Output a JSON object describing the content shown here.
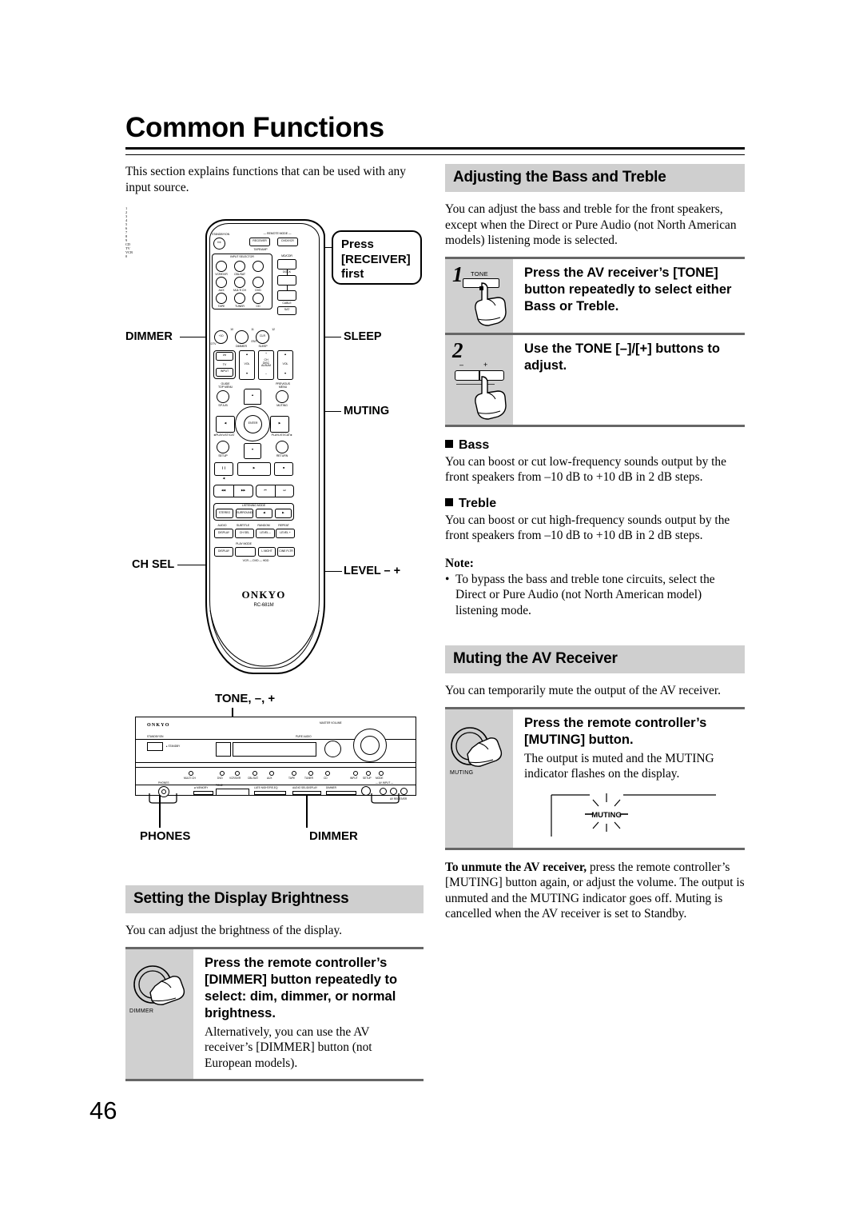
{
  "page": {
    "title": "Common Functions",
    "number": "46",
    "intro": "This section explains functions that can be used with any input source."
  },
  "sections": {
    "bass_treble": {
      "heading": "Adjusting the Bass and Treble",
      "intro": "You can adjust the bass and treble for the front speakers, except when the Direct or Pure Audio (not North American models) listening mode is selected.",
      "steps": [
        {
          "num": "1",
          "icon_label": "TONE",
          "title": "Press the AV receiver’s [TONE] button repeatedly to select either Bass or Treble.",
          "body": ""
        },
        {
          "num": "2",
          "icon_label_minus": "–",
          "icon_label_plus": "+",
          "title": "Use the TONE [–]/[+] buttons to adjust.",
          "body": ""
        }
      ],
      "subsections": [
        {
          "heading": "Bass",
          "body": "You can boost or cut low-frequency sounds output by the front speakers from –10 dB to +10 dB in 2 dB steps."
        },
        {
          "heading": "Treble",
          "body": "You can boost or cut high-frequency sounds output by the front speakers from –10 dB to +10 dB in 2 dB steps."
        }
      ],
      "note_label": "Note:",
      "notes": [
        "To bypass the bass and treble tone circuits, select the Direct or Pure Audio (not North American model) listening mode."
      ]
    },
    "muting": {
      "heading": "Muting the AV Receiver",
      "intro": "You can temporarily mute the output of the AV receiver.",
      "step": {
        "icon_label": "MUTING",
        "title": "Press the remote controller’s [MUTING] button.",
        "body": "The output is muted and the MUTING indicator flashes on the display.",
        "display_indicator": "MUTING"
      },
      "unmute_lead": "To unmute the AV receiver,",
      "unmute_body": " press the remote controller’s [MUTING] button again, or adjust the volume. The output is unmuted and the MUTING indicator goes off. Muting is cancelled when the AV receiver is set to Standby."
    },
    "display_brightness": {
      "heading": "Setting the Display Brightness",
      "intro": "You can adjust the brightness of the display.",
      "step": {
        "icon_label": "DIMMER",
        "title": "Press the remote controller’s [DIMMER] button repeatedly to select: dim, dimmer, or normal brightness.",
        "body": "Alternatively, you can use the AV receiver’s [DIMMER] button (not European models)."
      }
    }
  },
  "remote_figure": {
    "callout": "Press [RECEIVER] first",
    "model": "RC-681M",
    "brand": "ONKYO",
    "callouts": {
      "dimmer": "DIMMER",
      "sleep": "SLEEP",
      "muting": "MUTING",
      "ch_sel": "CH SEL",
      "level": "LEVEL – +"
    },
    "labels": {
      "standby": "STANDBY/ON",
      "remote_mode": "REMOTE MODE",
      "receiver_key": "RECEIVER",
      "dvd_key": "DVD/VCR",
      "tape_amp": "TAPE/AMP",
      "md_cdr": "MD/CDR",
      "cd_key": "CD",
      "dock": "DOCK",
      "tv_key": "TV",
      "vcr_key": "VCR",
      "cable": "CABLE",
      "sat_key": "SAT",
      "input_selector": "INPUT SELECTOR",
      "keys": [
        "1",
        "2",
        "3",
        "4",
        "5",
        "6",
        "7",
        "8",
        "9",
        "+10",
        "0",
        "CLR"
      ],
      "key_subs": [
        "VCR/DVR",
        "CBL/SAT",
        "",
        "AUX",
        "MULTI CH",
        "DVD",
        "TAPE",
        "TUNER",
        "CD"
      ],
      "key_nums": [
        "10",
        "11",
        "12"
      ],
      "dimmer_sub": "DIMMER",
      "sleep_sub": "SLEEP",
      "ent_sub": "ENT",
      "dtv_sub": "DTV",
      "tv_row": "TV",
      "vol": "VOL",
      "input_key": "INPUT",
      "ch_disc_album": "CH DISC ALBUM",
      "plus": "+",
      "minus": "–",
      "guide_top_menu": "GUIDE TOP MENU",
      "previous_menu": "PREVIOUS MENU",
      "sp_ab": "SP A /B",
      "muting_sub": "MUTING",
      "enter": "ENTER",
      "playlist_cat_l": "◄PLAYLIST/CAT",
      "playlist_cat_r": "PLAYLIST/CAT►",
      "setup": "SETUP",
      "return": "RETURN",
      "listening_mode": "LISTENING MODE",
      "stereo": "STEREO",
      "surround": "SURROUND",
      "audio": "AUDIO",
      "subtitle": "SUBTITLE",
      "random": "RANDOM",
      "repeat": "REPEAT",
      "display_key": "DISPLAY",
      "ch_sel_key": "CH SEL",
      "level_minus_key": "LEVEL –",
      "level_plus_key": "LEVEL +",
      "play_mode": "PLAY MODE",
      "l_night": "L NIGHT",
      "one_filter": "CINE FLTR",
      "vcr_dvd_hdd": "VCR — DVD — HDD"
    }
  },
  "receiver_figure": {
    "brand": "ONKYO",
    "callouts": {
      "tone": "TONE, –, +",
      "phones": "PHONES",
      "dimmer": "DIMMER"
    },
    "labels": {
      "standby_on": "STANDBY/ON",
      "pure_audio": "PURE AUDIO",
      "master_volume": "MASTER VOLUME",
      "phones": "PHONES",
      "standby": "STANDBY",
      "tone": "TONE",
      "dimmer": "DIMMER",
      "av_receiver": "AV RECEIVER"
    }
  },
  "colors": {
    "section_header_bg": "#cfcfcf",
    "step_gutter_bg": "#d0d0d0",
    "rule": "#666666",
    "text": "#000000"
  }
}
